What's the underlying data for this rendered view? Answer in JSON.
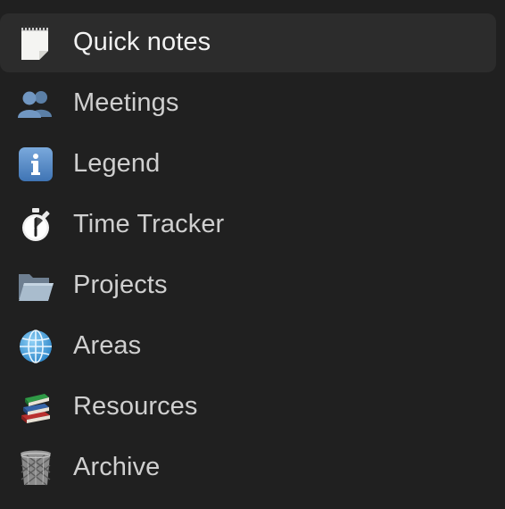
{
  "sidebar": {
    "items": [
      {
        "label": "Quick notes",
        "icon": "notepad-icon",
        "selected": true
      },
      {
        "label": "Meetings",
        "icon": "people-icon",
        "selected": false
      },
      {
        "label": "Legend",
        "icon": "info-icon",
        "selected": false
      },
      {
        "label": "Time Tracker",
        "icon": "stopwatch-icon",
        "selected": false
      },
      {
        "label": "Projects",
        "icon": "folder-icon",
        "selected": false
      },
      {
        "label": "Areas",
        "icon": "globe-icon",
        "selected": false
      },
      {
        "label": "Resources",
        "icon": "books-icon",
        "selected": false
      },
      {
        "label": "Archive",
        "icon": "trash-icon",
        "selected": false
      }
    ]
  },
  "colors": {
    "background": "#202020",
    "selected_row": "#2c2c2c",
    "text": "#cfcfcf",
    "text_selected": "#f2f2f2"
  }
}
